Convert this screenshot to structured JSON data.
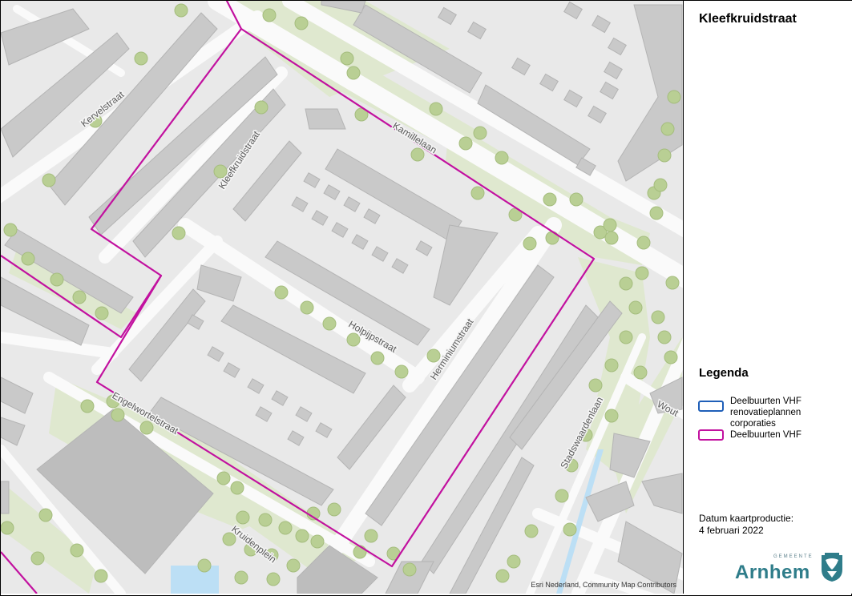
{
  "panel": {
    "title": "Kleefkruidstraat",
    "legend_title": "Legenda",
    "legend": [
      {
        "label": "Deelbuurten VHF renovatieplannen corporaties",
        "color": "#1f5fb8"
      },
      {
        "label": "Deelbuurten VHF",
        "color": "#c2119f"
      }
    ],
    "date_label": "Datum kaartproductie:",
    "date_value": "4 februari 2022",
    "logo_small": "GEMEENTE",
    "logo_text": "Arnhem"
  },
  "map": {
    "attribution": "Esri Nederland, Community Map Contributors",
    "streets": {
      "kervelstraat": "Kervelstraat",
      "kleefkruidstraat": "Kleefkruidstraat",
      "kamillelaan": "Kamillelaan",
      "holpijpstraat": "Holpijpstraat",
      "herminiumstraat": "Herminiumstraat",
      "engelwortelstraat": "Engelwortelstraat",
      "stadswaardenlaan": "Stadswaardenlaan",
      "kruidenplein": "Kruidenplein",
      "wout": "Wout"
    },
    "colors": {
      "background": "#e9e9e9",
      "road": "#fafafa",
      "building": "#c9c9c9",
      "green": "#dfe8cf",
      "tree": "#b9cf94",
      "water": "#bcdff5",
      "boundary": "#c2119f"
    }
  }
}
